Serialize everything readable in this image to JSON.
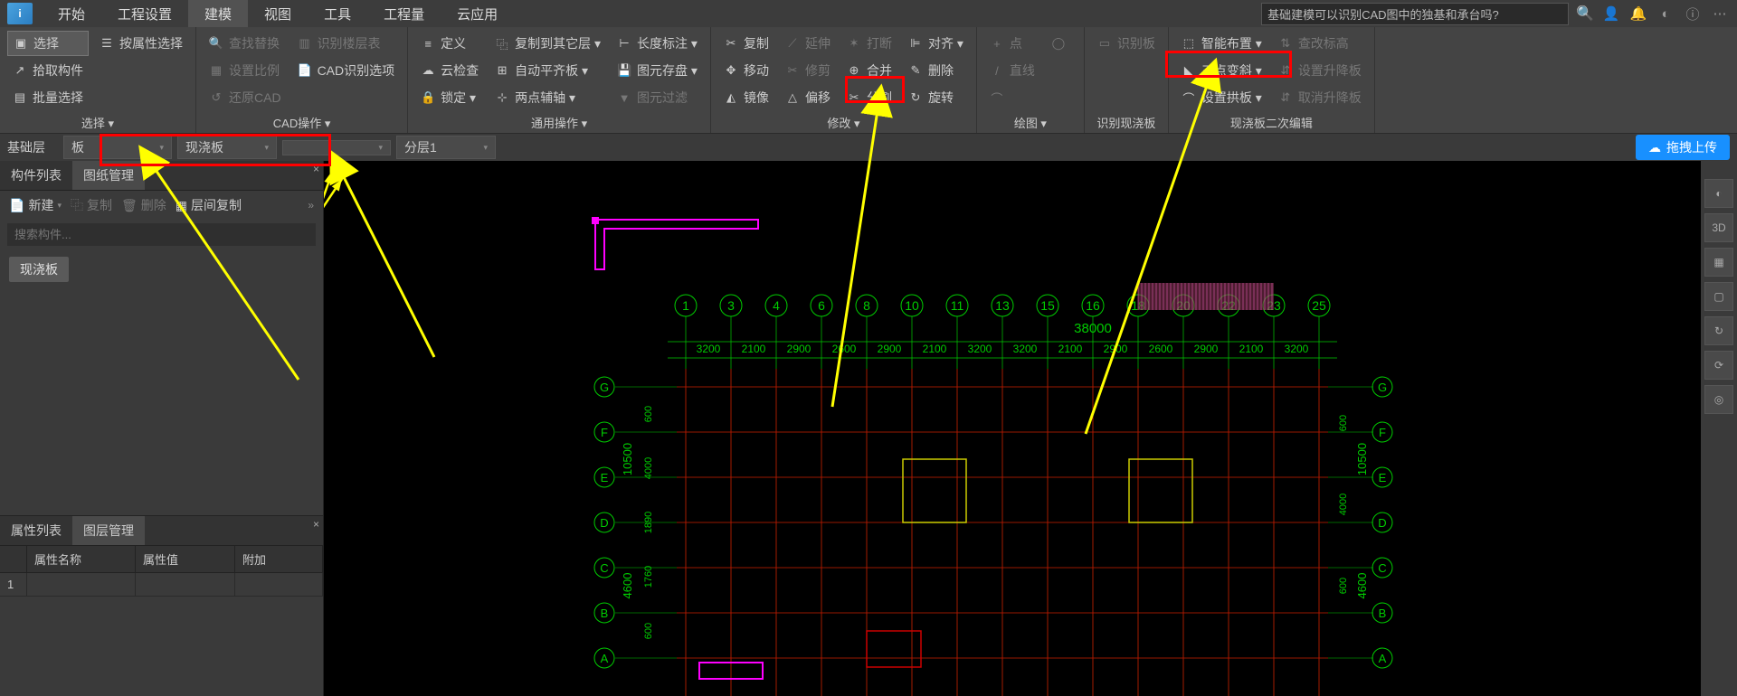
{
  "topmenu": {
    "items": [
      "开始",
      "工程设置",
      "建模",
      "视图",
      "工具",
      "工程量",
      "云应用"
    ],
    "active_index": 2,
    "search_text": "基础建模可以识别CAD图中的独基和承台吗?"
  },
  "ribbon": {
    "groups": [
      {
        "footer": "选择 ▾",
        "cols": [
          [
            {
              "icon": "▣",
              "label": "选择",
              "selected": true
            },
            {
              "icon": "↗",
              "label": "拾取构件"
            },
            {
              "icon": "▤",
              "label": "批量选择"
            }
          ],
          [
            {
              "icon": "☰",
              "label": "按属性选择"
            }
          ]
        ]
      },
      {
        "footer": "CAD操作 ▾",
        "cols": [
          [
            {
              "icon": "🔍",
              "label": "查找替换",
              "disabled": true
            },
            {
              "icon": "▦",
              "label": "设置比例",
              "disabled": true
            },
            {
              "icon": "↺",
              "label": "还原CAD",
              "disabled": true
            }
          ],
          [
            {
              "icon": "▥",
              "label": "识别楼层表",
              "disabled": true
            },
            {
              "icon": "📄",
              "label": "CAD识别选项"
            }
          ]
        ]
      },
      {
        "footer": "通用操作 ▾",
        "cols": [
          [
            {
              "icon": "≡",
              "label": "定义"
            },
            {
              "icon": "☁",
              "label": "云检查"
            },
            {
              "icon": "🔒",
              "label": "锁定 ▾"
            }
          ],
          [
            {
              "icon": "⿻",
              "label": "复制到其它层 ▾"
            },
            {
              "icon": "⊞",
              "label": "自动平齐板 ▾"
            },
            {
              "icon": "⊹",
              "label": "两点辅轴 ▾"
            }
          ],
          [
            {
              "icon": "⊢",
              "label": "长度标注 ▾"
            },
            {
              "icon": "💾",
              "label": "图元存盘 ▾"
            },
            {
              "icon": "▼",
              "label": "图元过滤",
              "disabled": true
            }
          ]
        ]
      },
      {
        "footer": "修改 ▾",
        "cols": [
          [
            {
              "icon": "✂",
              "label": "复制"
            },
            {
              "icon": "✥",
              "label": "移动"
            },
            {
              "icon": "◭",
              "label": "镜像"
            }
          ],
          [
            {
              "icon": "⟋",
              "label": "延伸",
              "disabled": true
            },
            {
              "icon": "✂",
              "label": "修剪",
              "disabled": true
            },
            {
              "icon": "△",
              "label": "偏移"
            }
          ],
          [
            {
              "icon": "✶",
              "label": "打断",
              "disabled": true
            },
            {
              "icon": "⊕",
              "label": "合并"
            },
            {
              "icon": "✂",
              "label": "分割"
            }
          ],
          [
            {
              "icon": "⊫",
              "label": "对齐 ▾"
            },
            {
              "icon": "✎",
              "label": "删除"
            },
            {
              "icon": "↻",
              "label": "旋转"
            }
          ]
        ]
      },
      {
        "footer": "绘图 ▾",
        "cols": [
          [
            {
              "icon": "+",
              "label": "点",
              "disabled": true
            },
            {
              "icon": "/",
              "label": "直线",
              "disabled": true
            },
            {
              "icon": "⌒",
              "label": "",
              "disabled": true
            }
          ],
          [
            {
              "icon": "◯",
              "label": "",
              "disabled": true
            }
          ]
        ]
      },
      {
        "footer": "识别现浇板",
        "cols": [
          [
            {
              "icon": "▭",
              "label": "识别板",
              "disabled": true
            }
          ]
        ]
      },
      {
        "footer": "现浇板二次编辑",
        "cols": [
          [
            {
              "icon": "⬚",
              "label": "智能布置 ▾"
            },
            {
              "icon": "◣",
              "label": "三点变斜 ▾"
            },
            {
              "icon": "⌒",
              "label": "设置拱板 ▾"
            }
          ],
          [
            {
              "icon": "⇅",
              "label": "查改标高",
              "disabled": true
            },
            {
              "icon": "⇵",
              "label": "设置升降板",
              "disabled": true
            },
            {
              "icon": "⇵",
              "label": "取消升降板",
              "disabled": true
            }
          ]
        ]
      }
    ]
  },
  "filterbar": {
    "floor": "基础层",
    "combo1": "板",
    "combo2": "现浇板",
    "combo3": "",
    "combo4": "分层1",
    "upload": "拖拽上传"
  },
  "leftpanel": {
    "tabs_upper": [
      "构件列表",
      "图纸管理"
    ],
    "tabs_upper_active": 1,
    "toolbar": {
      "new": "新建",
      "copy": "复制",
      "delete": "删除",
      "interlayer": "层间复制"
    },
    "search_placeholder": "搜索构件...",
    "item": "现浇板",
    "tabs_lower": [
      "属性列表",
      "图层管理"
    ],
    "tabs_lower_active": 1,
    "prop_headers": [
      "",
      "属性名称",
      "属性值",
      "附加"
    ],
    "prop_rows": [
      [
        "1",
        "",
        "",
        ""
      ]
    ]
  },
  "rightbar": {
    "tools": [
      "◐",
      "3D",
      "▦",
      "▢",
      "↻",
      "⟳",
      "◎"
    ]
  },
  "chart_data": {
    "type": "cad_floorplan",
    "grid_labels_top": [
      "1",
      "3",
      "4",
      "6",
      "8",
      "10",
      "11",
      "13",
      "15",
      "16",
      "18",
      "20",
      "22",
      "23",
      "25"
    ],
    "grid_labels_left": [
      "G",
      "F",
      "E",
      "D",
      "C",
      "B",
      "A"
    ],
    "grid_labels_right": [
      "G",
      "F",
      "E",
      "D",
      "C",
      "B",
      "A"
    ],
    "total_dimension_top": "38000",
    "dimensions_top_row": [
      "3200",
      "2100",
      "2900",
      "2600",
      "2900",
      "2100",
      "3200",
      "3200",
      "2100",
      "2900",
      "2600",
      "2900",
      "2100",
      "3200"
    ],
    "dimensions_left_col_outer": [
      "10500",
      "4600"
    ],
    "dimensions_left_col_inner": [
      "600",
      "4000",
      "1890",
      "1760",
      "600"
    ],
    "dimensions_right_col_outer": [
      "10500",
      "4600"
    ],
    "dimensions_right_col_inner": [
      "600",
      "4000",
      "600"
    ],
    "hatched_region": {
      "between_grids": [
        "16",
        "23"
      ],
      "row": "top"
    }
  }
}
